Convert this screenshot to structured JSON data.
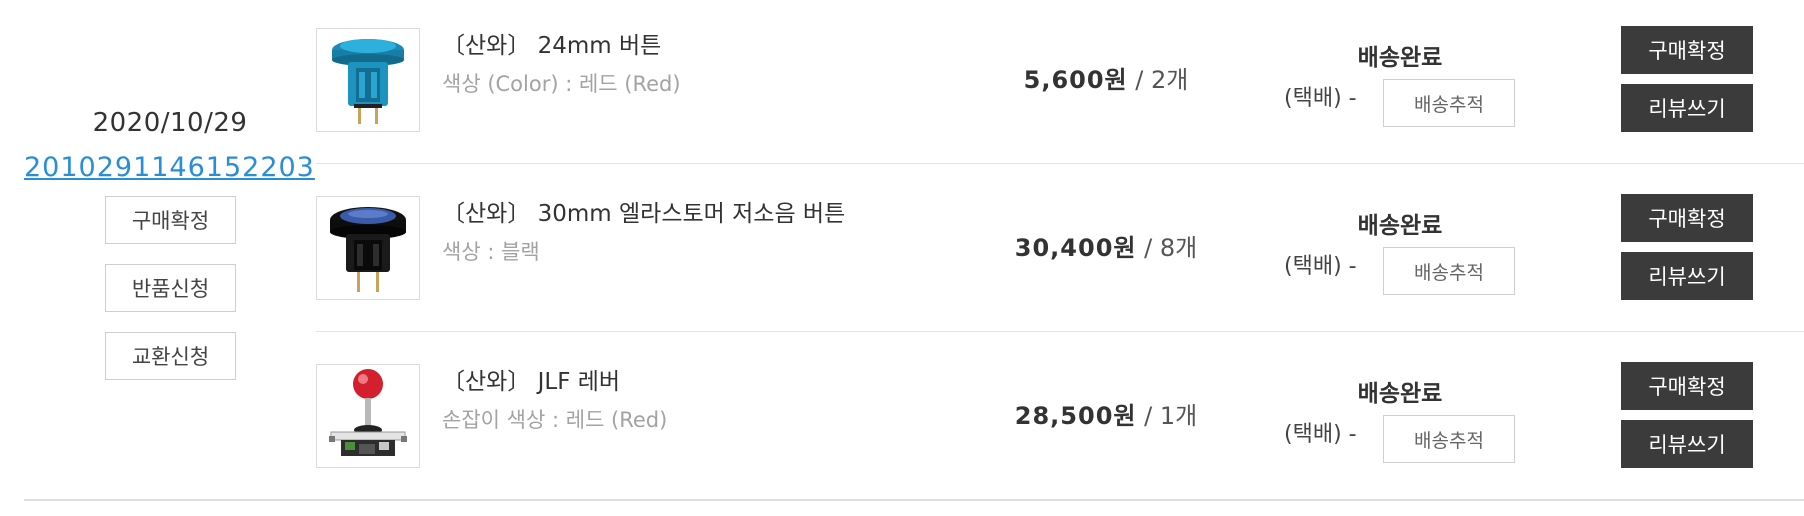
{
  "order": {
    "date": "2020/10/29",
    "number": "2010291146152203",
    "actions": {
      "confirm": "구매확정",
      "return": "반품신청",
      "exchange": "교환신청"
    }
  },
  "items": [
    {
      "name": "〔산와〕 24mm 버튼",
      "option": "색상 (Color) : 레드 (Red)",
      "price": "5,600원",
      "separator": "/",
      "qty": "2개",
      "status": "배송완료",
      "method": "(택배) -",
      "track_label": "배송추적",
      "confirm_label": "구매확정",
      "review_label": "리뷰쓰기",
      "image_icon": "blue-arcade-button-icon"
    },
    {
      "name": "〔산와〕 30mm 엘라스토머 저소음 버튼",
      "option": "색상 : 블랙",
      "price": "30,400원",
      "separator": "/",
      "qty": "8개",
      "status": "배송완료",
      "method": "(택배) -",
      "track_label": "배송추적",
      "confirm_label": "구매확정",
      "review_label": "리뷰쓰기",
      "image_icon": "black-arcade-button-icon"
    },
    {
      "name": "〔산와〕 JLF 레버",
      "option": "손잡이 색상 : 레드 (Red)",
      "price": "28,500원",
      "separator": "/",
      "qty": "1개",
      "status": "배송완료",
      "method": "(택배) -",
      "track_label": "배송추적",
      "confirm_label": "구매확정",
      "review_label": "리뷰쓰기",
      "image_icon": "joystick-lever-icon"
    }
  ],
  "colors": {
    "link": "#2a8dd8",
    "dark_button": "#3b3b3b",
    "option_text": "#a3a3a3",
    "border": "#cfcfcf"
  }
}
